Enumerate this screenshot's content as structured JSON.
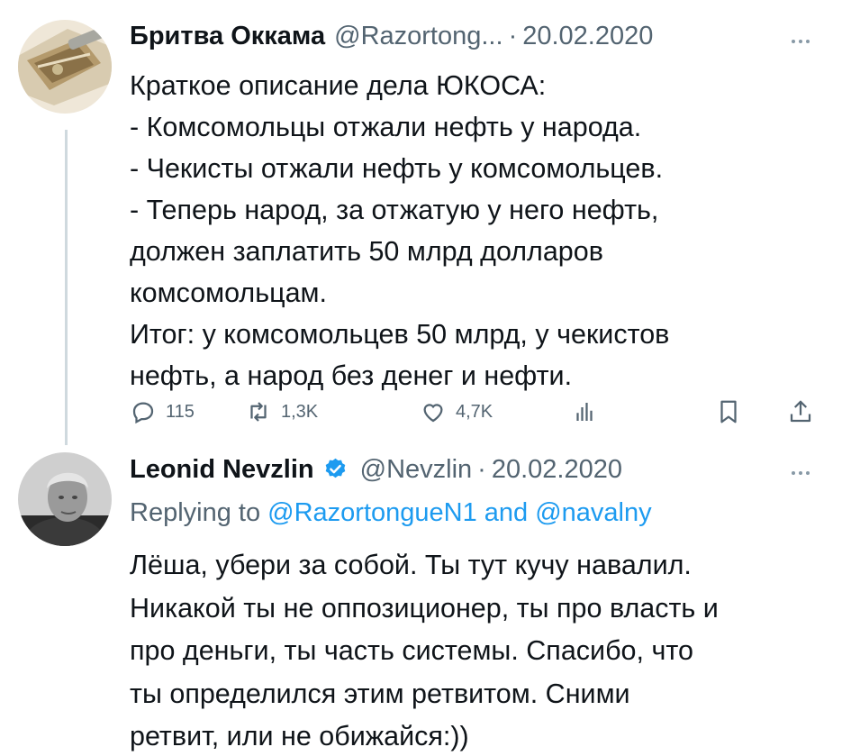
{
  "tweet1": {
    "author_name": "Бритва Оккама",
    "handle": "@Razortong...",
    "separator": "·",
    "date": "20.02.2020",
    "lines": [
      "Краткое описание дела ЮКОСА:",
      "- Комсомольцы отжали нефть у народа.",
      "- Чекисты отжали нефть у комсомольцев.",
      "- Теперь народ, за отжатую у него нефть,",
      "должен заплатить 50 млрд долларов",
      "комсомольцам.",
      "Итог: у комсомольцев 50 млрд, у чекистов",
      "нефть, а народ без денег и нефти."
    ],
    "actions": {
      "replies": "115",
      "retweets": "1,3K",
      "likes": "4,7K"
    }
  },
  "tweet2": {
    "author_name": "Leonid Nevzlin",
    "handle": "@Nevzlin",
    "separator": "·",
    "date": "20.02.2020",
    "verified": true,
    "replying_prefix": "Replying to ",
    "replying_to_1": "@RazortongueN1",
    "replying_and": " and ",
    "replying_to_2": "@navalny",
    "lines": [
      "Лёша, убери за собой. Ты тут кучу навалил.",
      "Никакой ты не оппозиционер, ты про власть и",
      "про деньги, ты часть системы. Спасибо, что",
      "ты определился этим ретвитом. Сними",
      "ретвит, или не обижайся:))"
    ]
  },
  "icons": {
    "reply": "comment-icon",
    "retweet": "retweet-icon",
    "like": "heart-icon",
    "views": "views-chart-icon",
    "bookmark": "bookmark-icon",
    "share": "share-icon",
    "more": "more-horizontal-icon",
    "verified": "verified-badge-icon"
  },
  "colors": {
    "text": "#0f1419",
    "secondary": "#536471",
    "link": "#1d9bf0",
    "thread_line": "#cfd9de"
  }
}
